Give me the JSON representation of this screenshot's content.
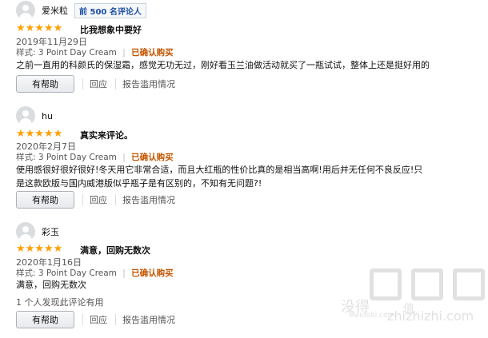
{
  "reviews": [
    {
      "username": "爱米粒",
      "rank_badge": "前 500 名评论人",
      "stars": "★★★★★",
      "title": "比我想象中要好",
      "date": "2019年11月29日",
      "style": "样式: 3 Point Day Cream",
      "separator": "|",
      "verified": "已确认购买",
      "body": "之前一直用的科颜氏的保湿霜，感觉无功无过，刚好看玉兰油做活动就买了一瓶试试，整体上还是挺好用的",
      "helpful_count": "",
      "helpful_button": "有帮助",
      "reply": "回应",
      "report": "报告滥用情况"
    },
    {
      "username": "hu",
      "rank_badge": "",
      "stars": "★★★★★",
      "title": "真实来评论。",
      "date": "2020年2月7日",
      "style": "样式: 3 Point Day Cream",
      "separator": "|",
      "verified": "已确认购买",
      "body": "使用感很好很好很好!冬天用它非常合适，而且大红瓶的性价比真的是相当高啊!用后并无任何不良反应!只是这款欧版与国内威港版似乎瓶子是有区别的，不知有无问题?!",
      "helpful_count": "",
      "helpful_button": "有帮助",
      "reply": "回应",
      "report": "报告滥用情况"
    },
    {
      "username": "彩玉",
      "rank_badge": "",
      "stars": "★★★★★",
      "title": "满意，回购无数次",
      "date": "2020年1月16日",
      "style": "样式: 3 Point Day Cream",
      "separator": "|",
      "verified": "已确认购买",
      "body": "满意，回购无数次",
      "helpful_count": "1 个人发现此评论有用",
      "helpful_button": "有帮助",
      "reply": "回应",
      "report": "报告滥用情况"
    }
  ],
  "watermark": {
    "line1": "没得",
    "line2": "值",
    "line3": "zhizhizhi.com",
    "site": "Meidebi.com"
  },
  "colors": {
    "star": "#ff9f00",
    "verified": "#c45500",
    "badge": "#1c4fa3"
  }
}
